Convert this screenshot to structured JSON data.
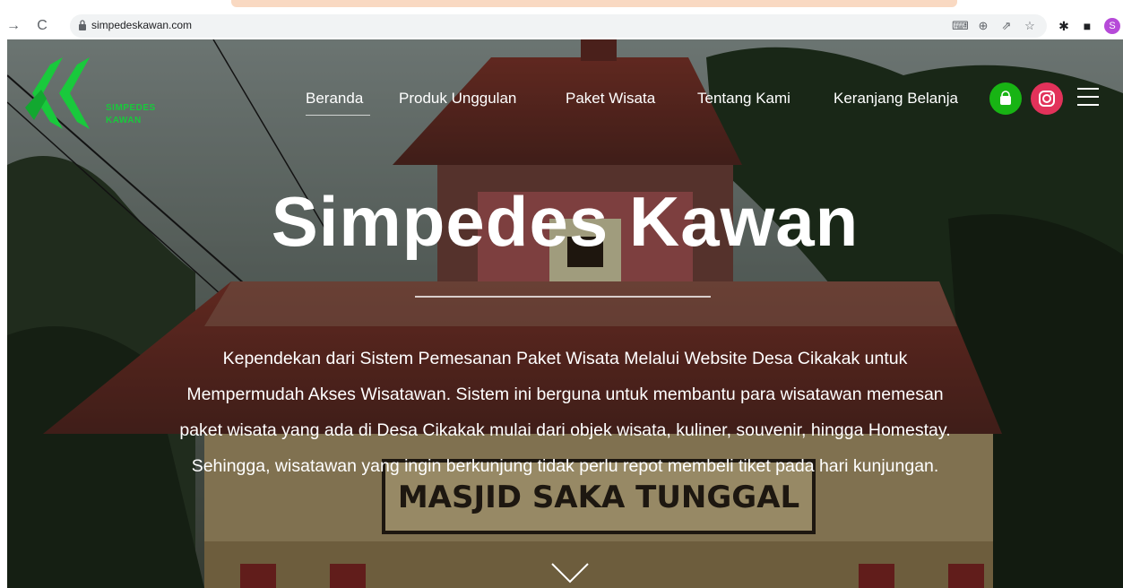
{
  "browser": {
    "url": "simpedeskawan.com",
    "profile_initial": "S"
  },
  "logo": {
    "line1": "SIMPEDES",
    "line2": "KAWAN"
  },
  "nav": {
    "items": [
      {
        "label": "Beranda"
      },
      {
        "label": "Produk Unggulan"
      },
      {
        "label": "Paket Wisata"
      },
      {
        "label": "Tentang Kami"
      },
      {
        "label": "Keranjang Belanja"
      }
    ]
  },
  "hero": {
    "title": "Simpedes Kawan",
    "description_lines": [
      "Kependekan dari Sistem Pemesanan Paket Wisata Melalui Website Desa Cikakak untuk",
      "Mempermudah Akses Wisatawan. Sistem ini berguna untuk membantu para wisatawan memesan",
      "paket wisata yang ada di Desa Cikakak mulai dari objek wisata, kuliner, souvenir, hingga Homestay.",
      "Sehingga, wisatawan yang ingin berkunjung tidak perlu repot membeli tiket pada hari kunjungan."
    ],
    "sign_text": "MASJID SAKA TUNGGAL"
  },
  "colors": {
    "logo_green": "#19c93c",
    "shop_green": "#18b414",
    "instagram_pink": "#e2325a"
  }
}
